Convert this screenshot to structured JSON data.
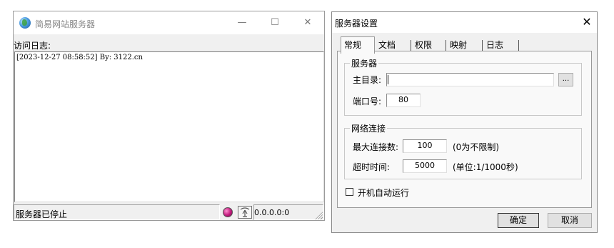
{
  "main_window": {
    "title": "简易网站服务器",
    "caption_buttons": {
      "minimize": "—",
      "maximize": "☐",
      "close": "✕"
    },
    "log_label": "访问日志:",
    "log_lines": [
      "[2023-12-27 08:58:52] By: 3122.cn"
    ],
    "status": {
      "text": "服务器已停止",
      "address": "0.0.0.0:0",
      "indicator_icon": "status-led-icon",
      "network_icon": "network-antenna-icon"
    }
  },
  "settings_dialog": {
    "title": "服务器设置",
    "close_glyph": "✕",
    "tabs": [
      "常规",
      "文档",
      "权限",
      "映射",
      "日志"
    ],
    "server_group": {
      "label": "服务器",
      "home_dir_label": "主目录:",
      "home_dir_value": "",
      "browse_label": "...",
      "port_label": "端口号:",
      "port_value": "80"
    },
    "network_group": {
      "label": "网络连接",
      "max_conn_label": "最大连接数:",
      "max_conn_value": "100",
      "max_conn_note": "(0为不限制)",
      "timeout_label": "超时时间:",
      "timeout_value": "5000",
      "timeout_note": "(单位:1/1000秒)"
    },
    "autostart_label": "开机自动运行",
    "autostart_checked": false,
    "ok_label": "确定",
    "cancel_label": "取消"
  }
}
